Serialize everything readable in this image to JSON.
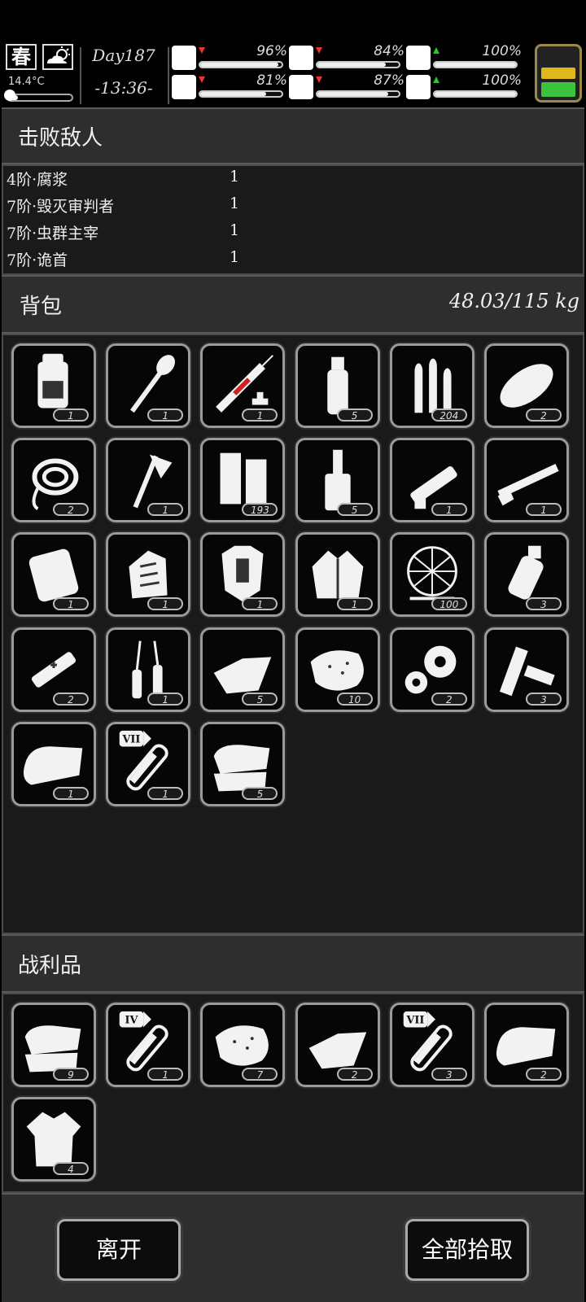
{
  "status": {
    "season": "春",
    "temperature": "14.4°C",
    "temperature_level": 0.15,
    "day": "Day187",
    "time": "-13:36-",
    "stats": [
      {
        "key": "health",
        "icon": "medkit-icon",
        "percent": "96%",
        "level": 0.96,
        "trend": "down"
      },
      {
        "key": "hunger",
        "icon": "stomach-icon",
        "percent": "84%",
        "level": 0.84,
        "trend": "down"
      },
      {
        "key": "mental",
        "icon": "head-icon",
        "percent": "100%",
        "level": 1.0,
        "trend": "up"
      },
      {
        "key": "stamina",
        "icon": "leg-icon",
        "percent": "81%",
        "level": 0.81,
        "trend": "down"
      },
      {
        "key": "thirst",
        "icon": "water-drop-icon",
        "percent": "87%",
        "level": 0.87,
        "trend": "down"
      },
      {
        "key": "mood",
        "icon": "heart-icon",
        "percent": "100%",
        "level": 1.0,
        "trend": "up"
      }
    ],
    "battery_colors": [
      "#e0b81c",
      "#3cc43c"
    ]
  },
  "enemies": {
    "title": "击败敌人",
    "rows": [
      {
        "name": "4阶·腐浆",
        "count": "1"
      },
      {
        "name": "7阶·毁灭审判者",
        "count": "1"
      },
      {
        "name": "7阶·虫群主宰",
        "count": "1"
      },
      {
        "name": "7阶·诡首",
        "count": "1"
      }
    ]
  },
  "backpack": {
    "title": "背包",
    "weight": "48.03/115 kg",
    "items": [
      {
        "icon": "backpack-icon",
        "qty": "1"
      },
      {
        "icon": "shovel-icon",
        "qty": "1"
      },
      {
        "icon": "syringe-icon",
        "qty": "1"
      },
      {
        "icon": "water-bottle-icon",
        "qty": "5"
      },
      {
        "icon": "bullets-icon",
        "qty": "204"
      },
      {
        "icon": "bread-icon",
        "qty": "2"
      },
      {
        "icon": "rope-icon",
        "qty": "2"
      },
      {
        "icon": "axe-icon",
        "qty": "1"
      },
      {
        "icon": "paper-roll-icon",
        "qty": "193"
      },
      {
        "icon": "liquor-bottle-icon",
        "qty": "5"
      },
      {
        "icon": "minigun-icon",
        "qty": "1"
      },
      {
        "icon": "shotgun-icon",
        "qty": "1"
      },
      {
        "icon": "storage-box-icon",
        "qty": "1"
      },
      {
        "icon": "armored-gloves-icon",
        "qty": "1"
      },
      {
        "icon": "body-armor-icon",
        "qty": "1"
      },
      {
        "icon": "jacket-icon",
        "qty": "1"
      },
      {
        "icon": "net-icon",
        "qty": "100"
      },
      {
        "icon": "grenade-icon",
        "qty": "3"
      },
      {
        "icon": "adrenaline-syringe-icon",
        "qty": "2"
      },
      {
        "icon": "ampoules-icon",
        "qty": "1"
      },
      {
        "icon": "cloth-icon",
        "qty": "5"
      },
      {
        "icon": "meat-chunk-icon",
        "qty": "10"
      },
      {
        "icon": "gears-icon",
        "qty": "2"
      },
      {
        "icon": "wood-planks-icon",
        "qty": "3"
      },
      {
        "icon": "folded-fabric-icon",
        "qty": "1"
      },
      {
        "icon": "test-tube-vii-icon",
        "qty": "1",
        "badge": "VII"
      },
      {
        "icon": "towels-icon",
        "qty": "5"
      }
    ]
  },
  "loot": {
    "title": "战利品",
    "items": [
      {
        "icon": "towels-icon",
        "qty": "9"
      },
      {
        "icon": "test-tube-iv-icon",
        "qty": "1",
        "badge": "IV"
      },
      {
        "icon": "meat-chunk-icon",
        "qty": "7"
      },
      {
        "icon": "cloth-icon",
        "qty": "2"
      },
      {
        "icon": "test-tube-vii-icon",
        "qty": "3",
        "badge": "VII"
      },
      {
        "icon": "folded-fabric-icon",
        "qty": "2"
      },
      {
        "icon": "torn-shirt-icon",
        "qty": "4"
      }
    ]
  },
  "buttons": {
    "leave": "离开",
    "take_all": "全部拾取"
  }
}
